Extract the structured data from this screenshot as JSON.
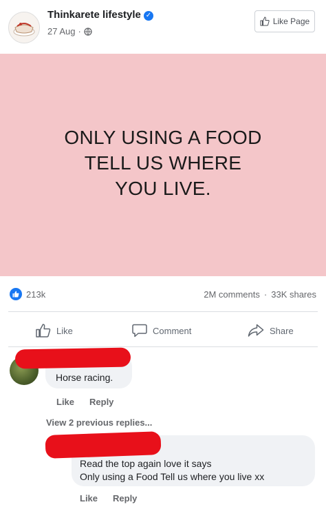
{
  "header": {
    "page_name": "Thinkarete lifestyle",
    "date": "27 Aug",
    "like_page_label": "Like Page"
  },
  "post": {
    "lines": [
      "ONLY USING A FOOD",
      "TELL US WHERE",
      "YOU LIVE."
    ],
    "background": "#f4c6c9"
  },
  "stats": {
    "reactions": "213k",
    "comments": "2M comments",
    "separator": "·",
    "shares": "33K shares"
  },
  "actions": {
    "like": "Like",
    "comment": "Comment",
    "share": "Share"
  },
  "comments": [
    {
      "text": "Horse racing.",
      "like": "Like",
      "reply": "Reply"
    },
    {
      "lines": [
        "Read the top again love it says",
        "Only using a Food Tell us where you live xx"
      ],
      "like": "Like",
      "reply": "Reply"
    }
  ],
  "view_previous": "View 2 previous replies...",
  "colors": {
    "accent": "#1877f2",
    "redaction": "#e8101a"
  }
}
